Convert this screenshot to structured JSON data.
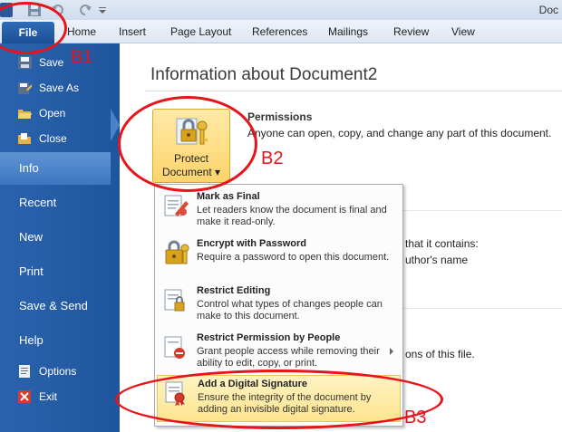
{
  "window": {
    "title": "Doc"
  },
  "ribbon": {
    "tabs": [
      "File",
      "Home",
      "Insert",
      "Page Layout",
      "References",
      "Mailings",
      "Review",
      "View"
    ]
  },
  "backstage": {
    "commands": [
      "Save",
      "Save As",
      "Open",
      "Close"
    ],
    "sections": [
      "Info",
      "Recent",
      "New",
      "Print",
      "Save & Send",
      "Help"
    ],
    "bottom": [
      "Options",
      "Exit"
    ],
    "selected": "Info"
  },
  "info": {
    "title": "Information about Document2",
    "protect_button": {
      "line1": "Protect",
      "line2": "Document ▾"
    },
    "permissions": {
      "heading": "Permissions",
      "description": "Anyone can open, copy, and change any part of this document."
    },
    "background_fragments": [
      "that it contains:",
      "uthor's name",
      "ons of this file."
    ]
  },
  "protect_menu": [
    {
      "title": "Mark as Final",
      "description": "Let readers know the document is final and make it read-only."
    },
    {
      "title": "Encrypt with Password",
      "description": "Require a password to open this document."
    },
    {
      "title": "Restrict Editing",
      "description": "Control what types of changes people can make to this document."
    },
    {
      "title": "Restrict Permission by People",
      "description": "Grant people access while removing their ability to edit, copy, or print."
    },
    {
      "title": "Add a Digital Signature",
      "description": "Ensure the integrity of the document by adding an invisible digital signature."
    }
  ],
  "annotations": [
    "B1",
    "B2",
    "B3"
  ],
  "colors": {
    "annotation": "#e8141b",
    "backstage": "#2a63ad",
    "highlight": "#fde48e"
  }
}
